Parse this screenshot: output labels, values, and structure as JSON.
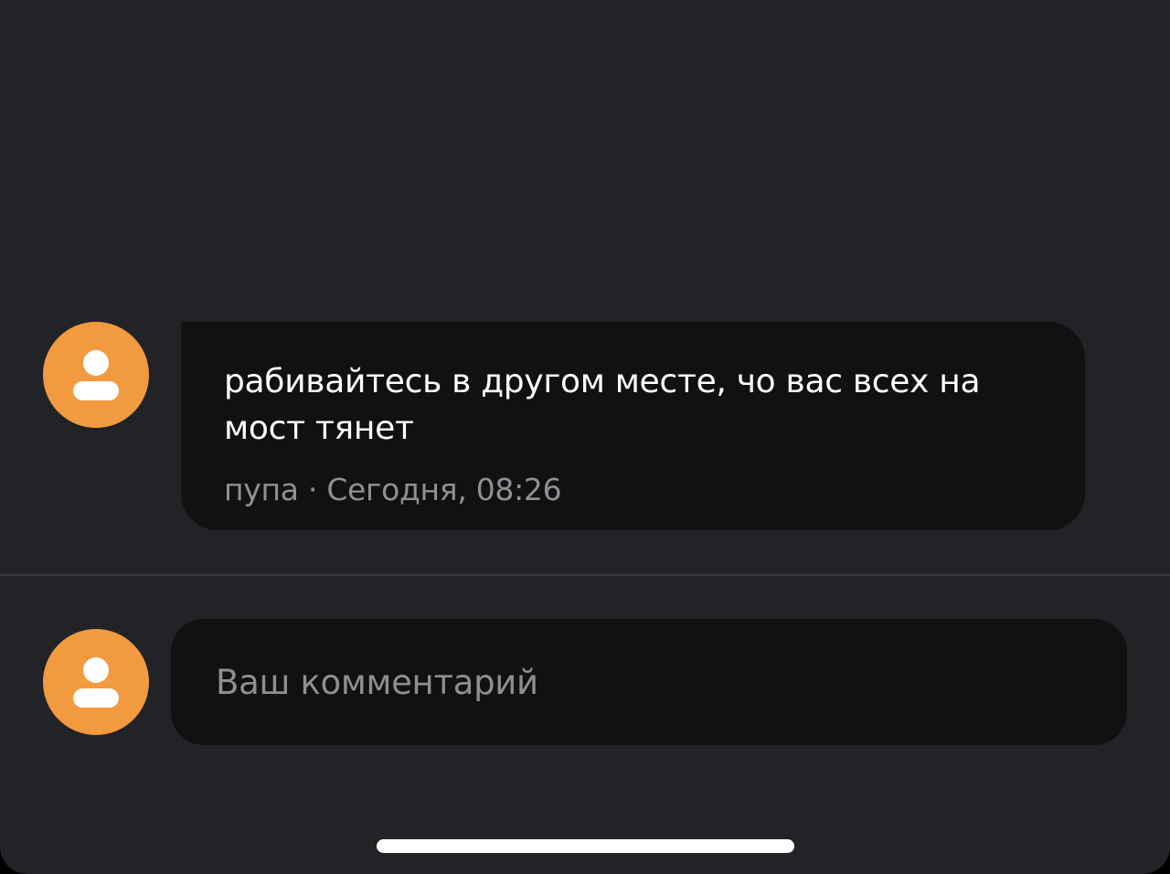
{
  "comment": {
    "text": "рабивайтесь в другом месте, чо вас всех на мост тянет",
    "author": "пупа",
    "separator": "·",
    "time": "Сегодня, 08:26"
  },
  "composer": {
    "placeholder": "Ваш комментарий",
    "value": ""
  },
  "icons": {
    "avatar": "user-silhouette-icon"
  },
  "colors": {
    "background": "#222327",
    "bubble": "#111112",
    "avatar": "#f29a40",
    "primary_text": "#ffffff",
    "secondary_text": "#8f9095",
    "divider": "#3a3b40"
  }
}
